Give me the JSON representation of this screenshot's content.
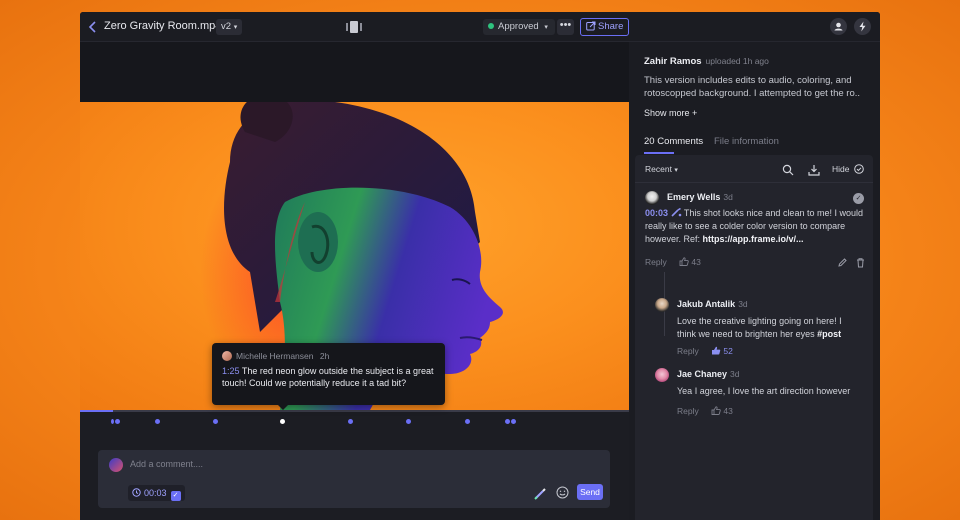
{
  "header": {
    "file_title": "Zero Gravity Room.mp4",
    "version": "v2",
    "status": "Approved",
    "more_label": "•••",
    "share_label": "Share"
  },
  "player": {
    "progress_fraction": 0.06,
    "tooltip": {
      "author": "Michelle Hermansen",
      "ago": "2h",
      "time": "1:25",
      "text": " The red neon glow outside the subject is a great touch! Could we potentially reduce it a tad bit?"
    }
  },
  "composer": {
    "placeholder": "Add a comment....",
    "timestamp": "00:03",
    "send_label": "Send"
  },
  "version_info": {
    "uploader": "Zahir Ramos",
    "uploaded_meta": "uploaded 1h ago",
    "description": "This version includes edits to audio, coloring, and rotoscopped background. I attempted to get the ro..",
    "show_more": "Show more +"
  },
  "tabs": {
    "comments": "20 Comments",
    "file_info": "File information"
  },
  "filters": {
    "sort": "Recent",
    "hide_label": "Hide"
  },
  "comments": [
    {
      "author": "Emery Wells",
      "ago": "3d",
      "time": "00:03",
      "text": " This shot looks nice and clean to me! I would really like to see a colder color version to compare however. Ref: ",
      "link": "https://app.frame.io/v/...",
      "reply": "Reply",
      "likes": "43"
    },
    {
      "author": "Jakub Antalik",
      "ago": "3d",
      "text": "Love the creative lighting going on here! I think we need to brighten her eyes ",
      "tag": "#post",
      "reply": "Reply",
      "likes": "52"
    },
    {
      "author": "Jae Chaney",
      "ago": "3d",
      "text": "Yea I agree, I love the art direction however",
      "reply": "Reply",
      "likes": "43"
    }
  ]
}
